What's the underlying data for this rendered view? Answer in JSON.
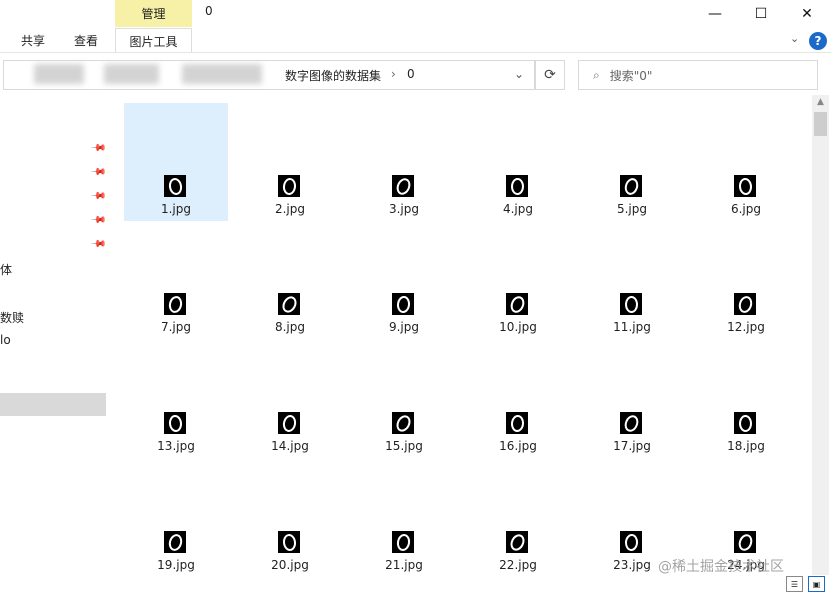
{
  "window": {
    "title": "0",
    "context_tab": "管理",
    "minimize": "—",
    "maximize": "☐",
    "close": "✕"
  },
  "ribbon": {
    "tabs": [
      "共享",
      "查看",
      "图片工具"
    ],
    "expand": "⌄",
    "help": "?"
  },
  "address": {
    "crumbs": [
      "数字图像的数据集",
      "0"
    ],
    "separator": "›",
    "dropdown": "⌄",
    "refresh": "⟳"
  },
  "search": {
    "icon": "⌕",
    "placeholder": "搜索\"0\""
  },
  "nav": {
    "pins": [
      "📌",
      "📌",
      "📌",
      "📌",
      "📌"
    ],
    "items": [
      "体",
      "数赎",
      "lo"
    ]
  },
  "files": [
    "1.jpg",
    "2.jpg",
    "3.jpg",
    "4.jpg",
    "5.jpg",
    "6.jpg",
    "7.jpg",
    "8.jpg",
    "9.jpg",
    "10.jpg",
    "11.jpg",
    "12.jpg",
    "13.jpg",
    "14.jpg",
    "15.jpg",
    "16.jpg",
    "17.jpg",
    "18.jpg",
    "19.jpg",
    "20.jpg",
    "21.jpg",
    "22.jpg",
    "23.jpg",
    "24.jpg"
  ],
  "selected_file": "1.jpg",
  "watermark": "@稀土掘金技术社区",
  "accent": "#1b6ac9"
}
